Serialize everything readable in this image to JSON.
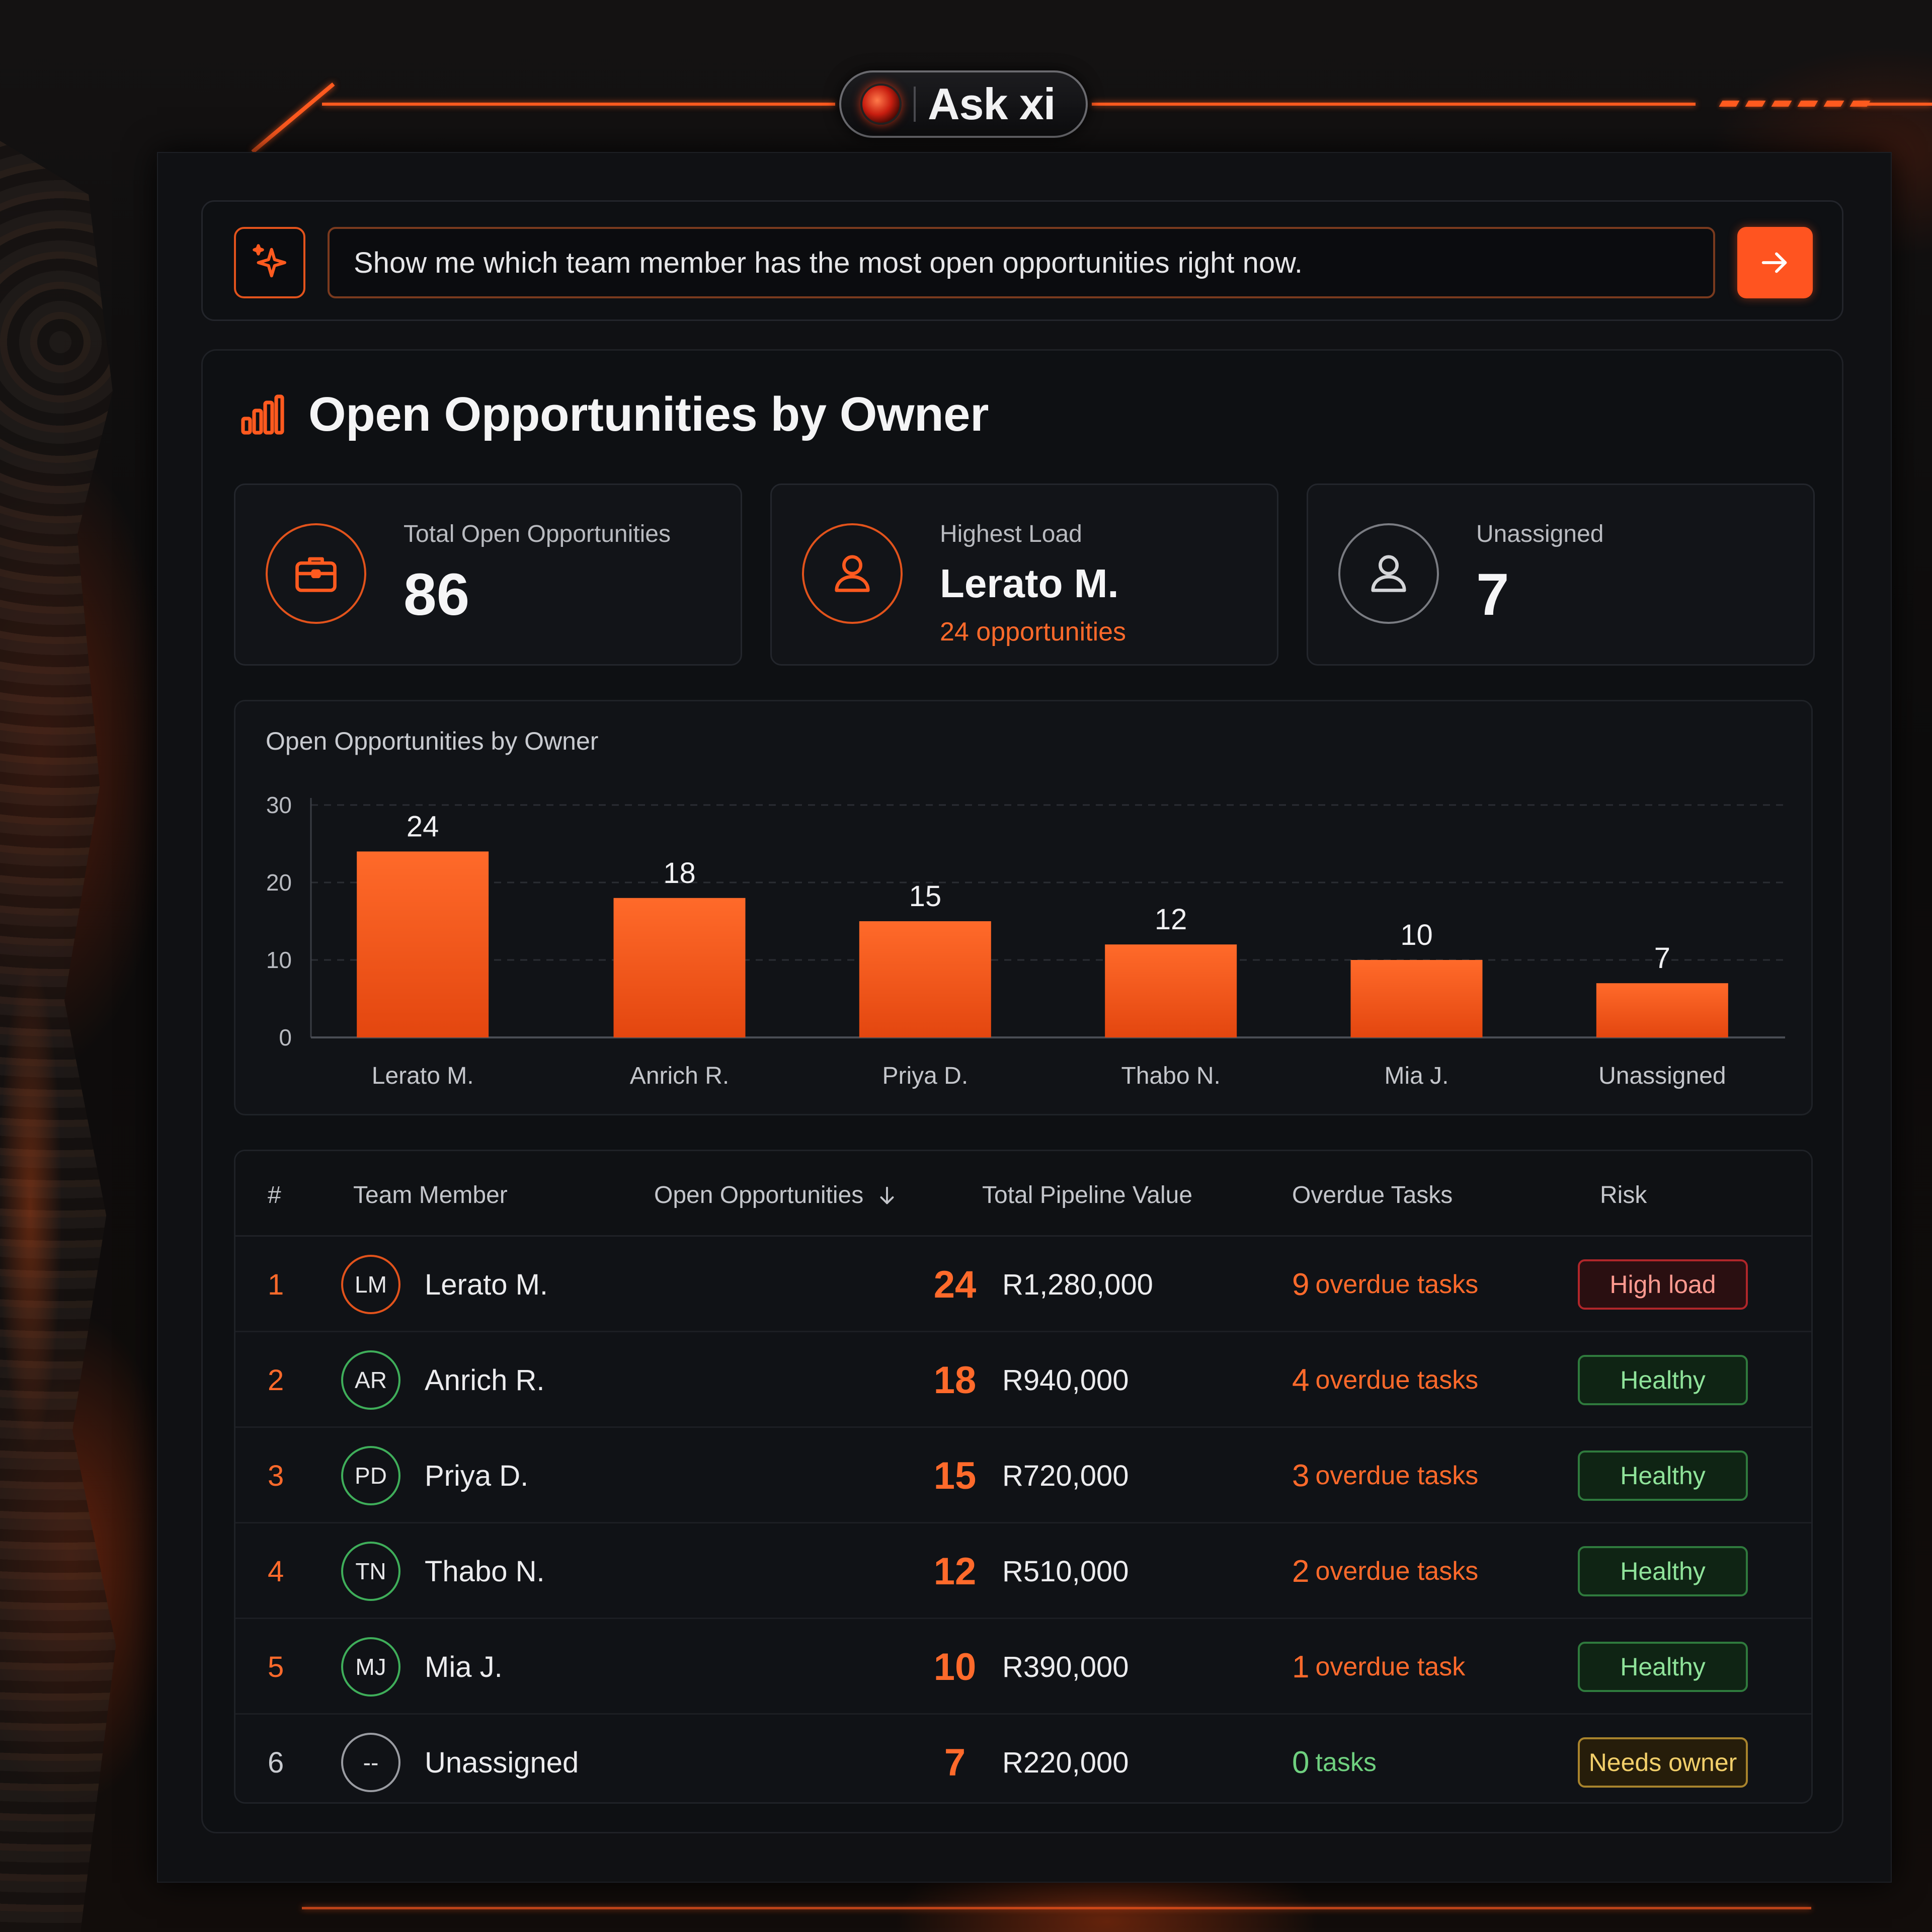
{
  "app": {
    "name": "Ask xi"
  },
  "query": {
    "text": "Show me which team member has the most open opportunities right now.",
    "send_icon": "arrow-right-icon",
    "assistant_icon": "sparkle-icon"
  },
  "report": {
    "title": "Open Opportunities by Owner",
    "icon": "bar-chart-icon"
  },
  "stats": [
    {
      "label": "Total Open Opportunities",
      "value": "86",
      "icon": "briefcase-icon"
    },
    {
      "label": "Highest Load",
      "value": "Lerato M.",
      "sub": "24 opportunities",
      "icon": "user-icon"
    },
    {
      "label": "Unassigned",
      "value": "7",
      "icon": "user-outline-icon"
    }
  ],
  "chart_data": {
    "type": "bar",
    "title": "Open Opportunities by Owner",
    "categories": [
      "Lerato M.",
      "Anrich R.",
      "Priya D.",
      "Thabo N.",
      "Mia J.",
      "Unassigned"
    ],
    "values": [
      24,
      18,
      15,
      12,
      10,
      7
    ],
    "ylim": [
      0,
      30
    ],
    "yticks": [
      0,
      10,
      20,
      30
    ],
    "grid": true,
    "bar_color": "#ff5a1f"
  },
  "table": {
    "headers": {
      "rank": "#",
      "member": "Team Member",
      "opps": "Open Opportunities",
      "pipeline": "Total Pipeline Value",
      "overdue": "Overdue Tasks",
      "risk": "Risk"
    },
    "sort_icon": "arrow-down-icon",
    "rows": [
      {
        "rank": "1",
        "initials": "LM",
        "name": "Lerato M.",
        "opps": "24",
        "pipeline": "R1,280,000",
        "overdue_num": "9",
        "overdue_text": "overdue tasks",
        "risk": "High load",
        "risk_level": "high"
      },
      {
        "rank": "2",
        "initials": "AR",
        "name": "Anrich R.",
        "opps": "18",
        "pipeline": "R940,000",
        "overdue_num": "4",
        "overdue_text": "overdue tasks",
        "risk": "Healthy",
        "risk_level": "healthy"
      },
      {
        "rank": "3",
        "initials": "PD",
        "name": "Priya D.",
        "opps": "15",
        "pipeline": "R720,000",
        "overdue_num": "3",
        "overdue_text": "overdue tasks",
        "risk": "Healthy",
        "risk_level": "healthy"
      },
      {
        "rank": "4",
        "initials": "TN",
        "name": "Thabo N.",
        "opps": "12",
        "pipeline": "R510,000",
        "overdue_num": "2",
        "overdue_text": "overdue tasks",
        "risk": "Healthy",
        "risk_level": "healthy"
      },
      {
        "rank": "5",
        "initials": "MJ",
        "name": "Mia J.",
        "opps": "10",
        "pipeline": "R390,000",
        "overdue_num": "1",
        "overdue_text": "overdue task",
        "risk": "Healthy",
        "risk_level": "healthy"
      },
      {
        "rank": "6",
        "initials": "--",
        "name": "Unassigned",
        "opps": "7",
        "pipeline": "R220,000",
        "overdue_num": "0",
        "overdue_text": "tasks",
        "risk": "Needs owner",
        "risk_level": "owner"
      }
    ]
  },
  "colors": {
    "accent": "#ff5a1f",
    "danger": "#b0262a",
    "success": "#3fae5a",
    "warning": "#a8832c"
  }
}
